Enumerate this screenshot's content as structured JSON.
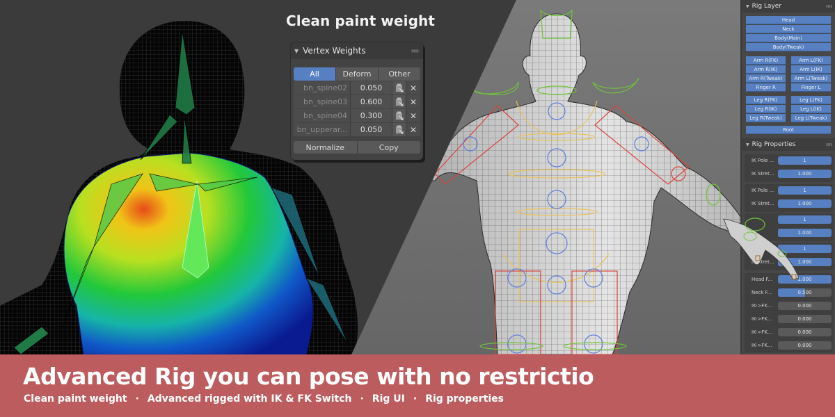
{
  "headline": "Clean paint weight",
  "vertex_weights": {
    "title": "Vertex Weights",
    "tabs": [
      {
        "label": "All",
        "active": true
      },
      {
        "label": "Deform",
        "active": false
      },
      {
        "label": "Other",
        "active": false
      }
    ],
    "rows": [
      {
        "group": "bn_spine02",
        "weight": "0.050"
      },
      {
        "group": "bn_spine03",
        "weight": "0.600"
      },
      {
        "group": "bn_spine04",
        "weight": "0.300"
      },
      {
        "group": "bn_upperar...",
        "weight": "0.050"
      }
    ],
    "actions": {
      "normalize": "Normalize",
      "copy": "Copy"
    },
    "paste_icon": "paste-icon",
    "delete_icon": "close-icon"
  },
  "rig_layer": {
    "title": "Rig Layer",
    "full_width": [
      "Head",
      "Neck",
      "Body(Main)",
      "Body(Tweak)"
    ],
    "arm_left_col": [
      "Arm R(FK)",
      "Arm R(IK)",
      "Arm R(Tweak)",
      "Finger R"
    ],
    "arm_right_col": [
      "Arm L(FK)",
      "Arm L(IK)",
      "Arm L(Tweak)",
      "Finger L"
    ],
    "leg_left_col": [
      "Leg R(FK)",
      "Leg R(IK)",
      "Leg R(Tweak)"
    ],
    "leg_right_col": [
      "Leg L(FK)",
      "Leg L(IK)",
      "Leg L(Tweak)"
    ],
    "root": "Root"
  },
  "rig_properties": {
    "title": "Rig Properties",
    "ik_groups": [
      {
        "pole_label": "IK Pole ...",
        "pole_value": "1",
        "stretch_label": "IK Stret...",
        "stretch_value": "1.000"
      },
      {
        "pole_label": "IK Pole ...",
        "pole_value": "1",
        "stretch_label": "IK Stret...",
        "stretch_value": "1.000"
      },
      {
        "pole_label": "",
        "pole_value": "1",
        "stretch_label": "",
        "stretch_value": "1.000"
      },
      {
        "pole_label": "IK Pole ...",
        "pole_value": "1",
        "stretch_label": "IK Stret...",
        "stretch_value": "1.000"
      }
    ],
    "sliders": [
      {
        "label": "Head F...",
        "value": "1.000",
        "fraction": 1.0
      },
      {
        "label": "Neck F...",
        "value": "0.500",
        "fraction": 0.5
      },
      {
        "label": "IK->FK...",
        "value": "0.000",
        "fraction": 0.0
      },
      {
        "label": "IK->FK...",
        "value": "0.000",
        "fraction": 0.0
      },
      {
        "label": "IK->FK...",
        "value": "0.000",
        "fraction": 0.0
      },
      {
        "label": "IK->FK...",
        "value": "0.000",
        "fraction": 0.0
      }
    ]
  },
  "banner": {
    "title": "Advanced Rig you can pose with no restrictio",
    "features": [
      "Clean paint weight",
      "Advanced rigged with IK & FK Switch",
      "Rig UI",
      "Rig properties"
    ],
    "separator": "·",
    "color": "#bd5c5e"
  },
  "colors": {
    "accent_blue": "#5680c2",
    "panel_bg": "#434343",
    "viewport_dark": "#3b3b3b",
    "viewport_light": "#737373"
  }
}
